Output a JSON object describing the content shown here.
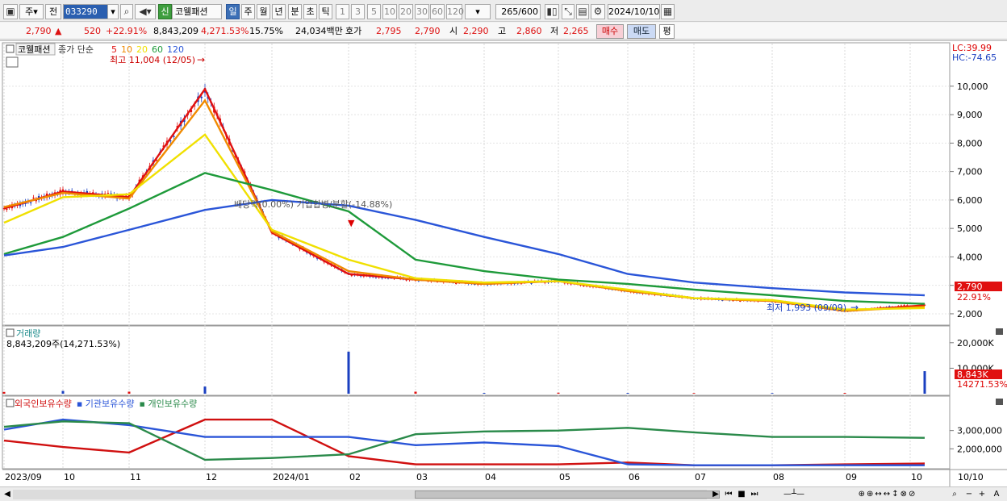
{
  "toolbar": {
    "market_type": "주",
    "prev_label": "전",
    "stock_code": "033290",
    "sin_label": "신",
    "stock_name": "코웰패션",
    "periods": [
      "일",
      "주",
      "월",
      "년",
      "분",
      "초",
      "틱"
    ],
    "selected_period": "일",
    "intervals": [
      "1",
      "3",
      "5",
      "10",
      "20",
      "30",
      "60",
      "120"
    ],
    "count_display": "265",
    "count_total": "/600",
    "date": "2024/10/10"
  },
  "quote": {
    "price": "2,790",
    "change": "520",
    "change_pct": "+22.91%",
    "volume": "8,843,209",
    "volume_pct": "4,271.53%",
    "turnover": "15.75%",
    "amount": "24,034백만",
    "hoga_label": "호가",
    "ask": "2,795",
    "bid": "2,790",
    "open_label": "시",
    "open": "2,290",
    "high_label": "고",
    "high": "2,860",
    "low_label": "저",
    "low": "2,265",
    "buy_label": "매수",
    "sell_label": "매도",
    "flat_label": "평"
  },
  "price_panel": {
    "stock_tab": "코웰패션",
    "legend_prefix": "종가 단순",
    "ma_periods": [
      "5",
      "10",
      "20",
      "60",
      "120"
    ],
    "ma_colors": [
      "#e01010",
      "#f08a00",
      "#f0e000",
      "#1e9a3a",
      "#2a55d8"
    ],
    "high_note": "최고 11,004 (12/05)",
    "low_note": "최저 1,993 (09/09)",
    "event_note": "배당락(0.00%) 기업합병/분할(-14.88%)",
    "lc": "LC:39.99",
    "hc": "HC:-74.65",
    "price_tag": "2,790",
    "pct_tag": "22.91%",
    "y_ticks": [
      "10,000",
      "9,000",
      "8,000",
      "7,000",
      "6,000",
      "5,000",
      "4,000",
      "3,000",
      "2,000"
    ]
  },
  "volume_panel": {
    "title": "거래량",
    "info": "8,843,209주(14,271.53%)",
    "tag": "8,843K",
    "pct_tag": "14271.53%",
    "y_ticks": [
      "20,000K",
      "10,000K"
    ]
  },
  "holding_panel": {
    "legend": [
      "외국인보유수량",
      "기관보유수량",
      "개인보유수량"
    ],
    "legend_colors": [
      "#d01010",
      "#2a55d8",
      "#2a8a4a"
    ],
    "y_ticks": [
      "3,000,000",
      "2,000,000"
    ]
  },
  "x_axis": [
    "2023/09",
    "10",
    "11",
    "12",
    "2024/01",
    "02",
    "03",
    "04",
    "05",
    "06",
    "07",
    "08",
    "09",
    "10"
  ],
  "x_axis_right": "10/10",
  "chart_data": [
    {
      "type": "line",
      "title": "코웰패션 종가 단순",
      "x": [
        "2023/09",
        "2023/10",
        "2023/11",
        "2023/12",
        "2024/01",
        "2024/02",
        "2024/03",
        "2024/04",
        "2024/05",
        "2024/06",
        "2024/07",
        "2024/08",
        "2024/09",
        "2024/10"
      ],
      "series": [
        {
          "name": "5",
          "values": [
            5700,
            6300,
            6100,
            9900,
            4850,
            3400,
            3200,
            3050,
            3150,
            2800,
            2550,
            2450,
            2100,
            2300
          ]
        },
        {
          "name": "10",
          "values": [
            5750,
            6250,
            6050,
            9500,
            4900,
            3500,
            3200,
            3050,
            3150,
            2800,
            2550,
            2450,
            2100,
            2250
          ]
        },
        {
          "name": "20",
          "values": [
            5200,
            6100,
            6200,
            8300,
            4950,
            3900,
            3250,
            3100,
            3150,
            2850,
            2550,
            2480,
            2150,
            2200
          ]
        },
        {
          "name": "60",
          "values": [
            4100,
            4700,
            5700,
            6950,
            6350,
            5600,
            3900,
            3500,
            3200,
            3050,
            2850,
            2650,
            2450,
            2350
          ]
        },
        {
          "name": "120",
          "values": [
            4050,
            4350,
            4950,
            5650,
            6000,
            5800,
            5300,
            4700,
            4100,
            3400,
            3100,
            2900,
            2750,
            2650
          ]
        }
      ],
      "ylim": [
        1800,
        11300
      ]
    },
    {
      "type": "bar",
      "title": "거래량",
      "x": [
        "2023/09",
        "2023/10",
        "2023/11",
        "2023/12",
        "2024/01",
        "2024/02",
        "2024/03",
        "2024/04",
        "2024/05",
        "2024/06",
        "2024/07",
        "2024/08",
        "2024/09",
        "2024/10"
      ],
      "values_k": [
        700,
        1100,
        800,
        2800,
        0,
        16500,
        800,
        300,
        400,
        300,
        250,
        250,
        300,
        8843
      ],
      "ylim": [
        0,
        25000
      ]
    },
    {
      "type": "line",
      "title": "보유수량",
      "x": [
        "2023/09",
        "2023/10",
        "2023/11",
        "2023/12",
        "2024/01",
        "2024/02",
        "2024/03",
        "2024/04",
        "2024/05",
        "2024/06",
        "2024/07",
        "2024/08",
        "2024/09",
        "2024/10"
      ],
      "series": [
        {
          "name": "외국인보유수량",
          "values": [
            2450000,
            2100000,
            1800000,
            3600000,
            3600000,
            1600000,
            1150000,
            1150000,
            1150000,
            1250000,
            1100000,
            1100000,
            1150000,
            1200000
          ]
        },
        {
          "name": "기관보유수량",
          "values": [
            3050000,
            3600000,
            3300000,
            2650000,
            2650000,
            2650000,
            2200000,
            2350000,
            2150000,
            1150000,
            1100000,
            1100000,
            1100000,
            1100000
          ]
        },
        {
          "name": "개인보유수량",
          "values": [
            3200000,
            3500000,
            3400000,
            1400000,
            1500000,
            1700000,
            2800000,
            2950000,
            3000000,
            3150000,
            2900000,
            2650000,
            2650000,
            2600000
          ]
        }
      ],
      "ylim": [
        1000000,
        4000000
      ]
    }
  ]
}
